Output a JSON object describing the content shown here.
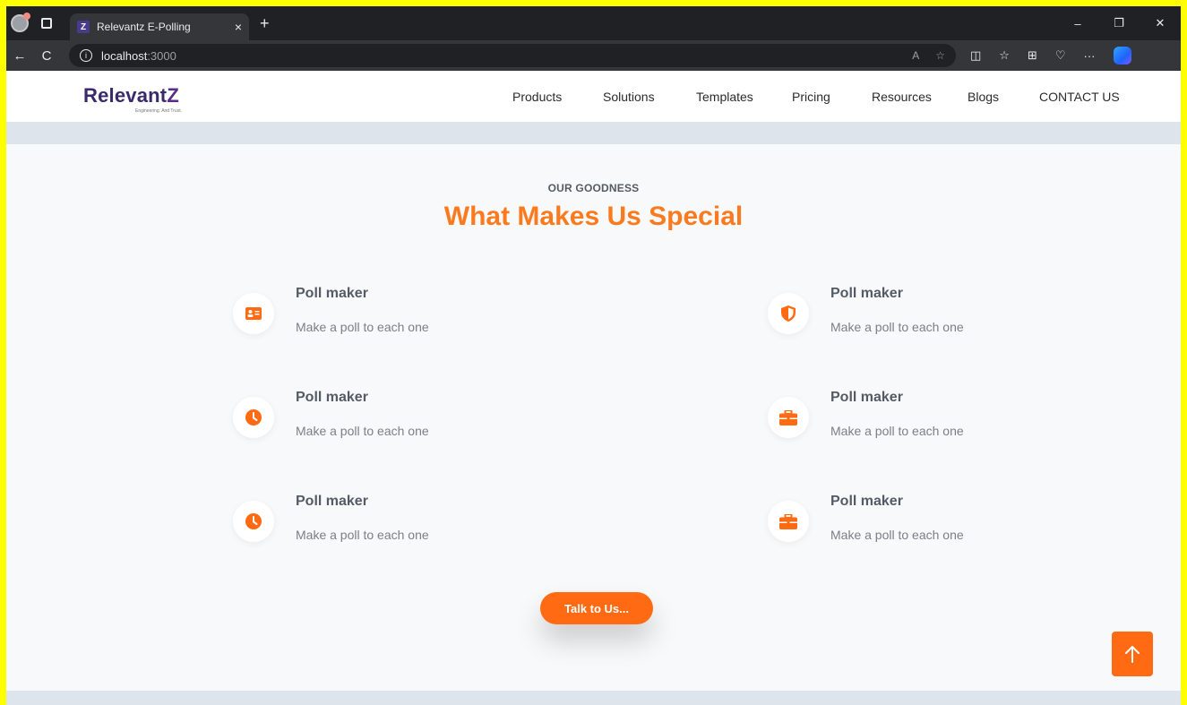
{
  "browser": {
    "tab_title": "Relevantz E-Polling",
    "tab_close": "×",
    "new_tab": "+",
    "favicon_letter": "Z",
    "url_host": "localhost",
    "url_port": ":3000",
    "window_minimize": "–",
    "window_restore": "❐",
    "window_close": "✕",
    "back": "←",
    "reload": "C",
    "read_aloud": "A",
    "favorite": "☆",
    "more": "···"
  },
  "brand": {
    "logo_text": "Relevant",
    "logo_z": "Z",
    "tagline": "Engineering. And Trust."
  },
  "nav": {
    "items": [
      {
        "label": "Products"
      },
      {
        "label": "Solutions"
      },
      {
        "label": "Templates"
      },
      {
        "label": "Pricing"
      },
      {
        "label": "Resources"
      },
      {
        "label": "Blogs"
      },
      {
        "label": "CONTACT US"
      }
    ]
  },
  "section": {
    "eyebrow": "OUR GOODNESS",
    "title": "What Makes Us Special",
    "features": [
      {
        "title": "Poll maker",
        "description": "Make a poll to each one",
        "icon": "id-card-icon"
      },
      {
        "title": "Poll maker",
        "description": "Make a poll to each one",
        "icon": "shield-icon"
      },
      {
        "title": "Poll maker",
        "description": "Make a poll to each one",
        "icon": "clock-icon"
      },
      {
        "title": "Poll maker",
        "description": "Make a poll to each one",
        "icon": "briefcase-icon"
      },
      {
        "title": "Poll maker",
        "description": "Make a poll to each one",
        "icon": "clock-icon"
      },
      {
        "title": "Poll maker",
        "description": "Make a poll to each one",
        "icon": "briefcase-icon"
      }
    ]
  },
  "cta": {
    "label": "Talk to Us..."
  },
  "colors": {
    "accent": "#ff6a13",
    "heading": "#fc7a1e",
    "brand": "#3b2a6b"
  }
}
